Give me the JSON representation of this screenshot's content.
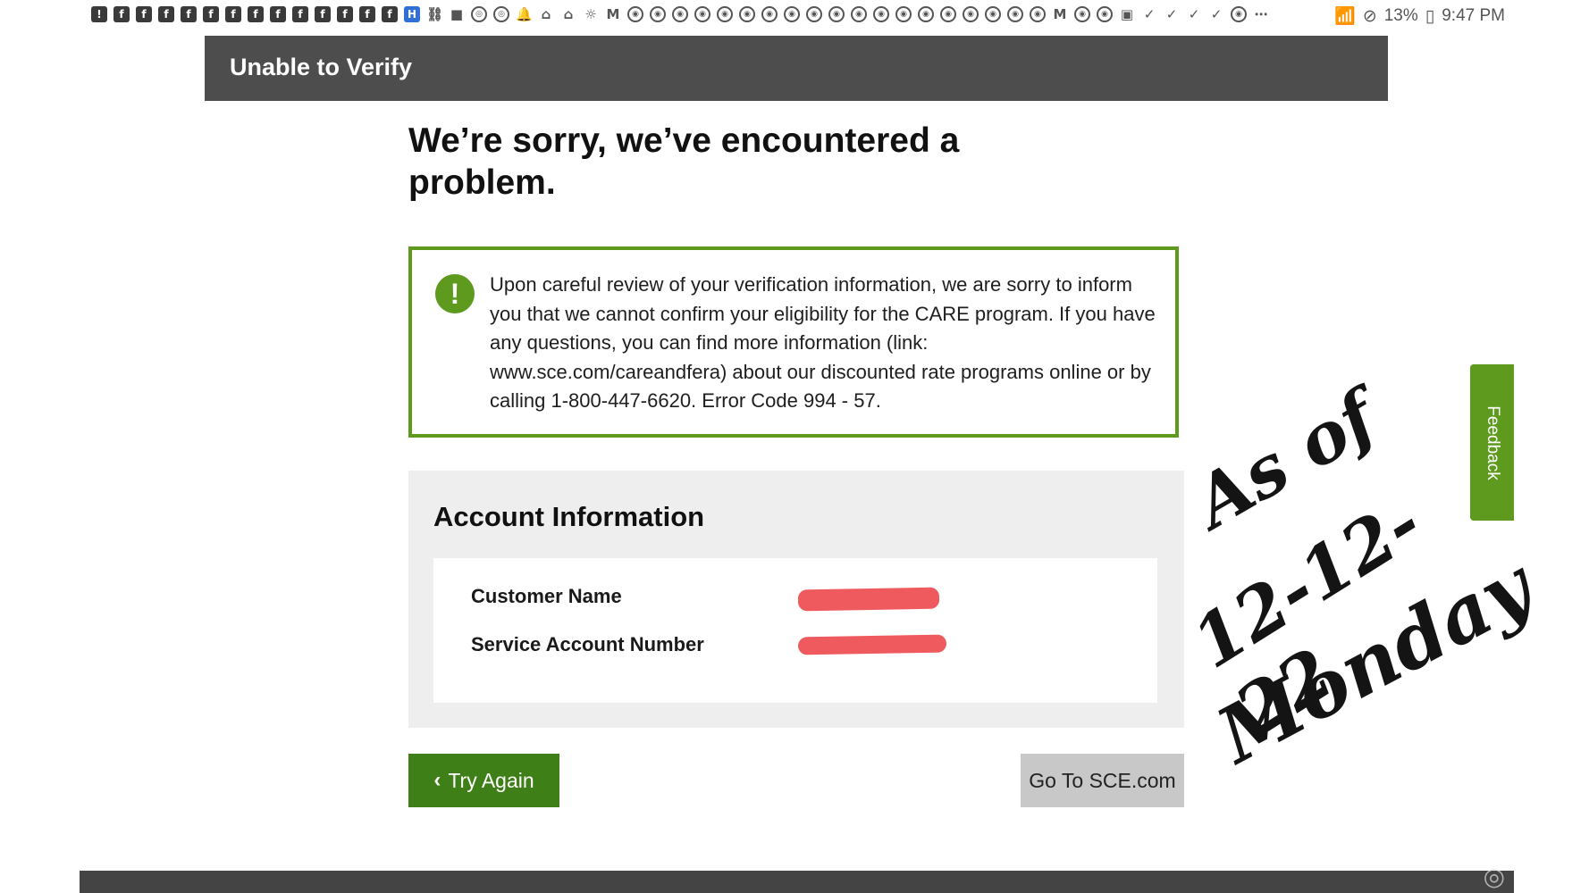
{
  "status_bar": {
    "icons": [
      "notification-icons"
    ],
    "battery": "13%",
    "time": "9:47 PM"
  },
  "header": {
    "title": "Unable to Verify"
  },
  "page": {
    "title": "We’re sorry, we’ve encountered a problem."
  },
  "alert": {
    "message": "Upon careful review of your verification information, we are sorry to inform you that we cannot confirm your eligibility for the CARE program. If you have any questions, you can find more information (link: www.sce.com/careandfera) about our discounted rate programs online or by calling 1-800-447-6620. Error Code 994 - 57."
  },
  "account_info": {
    "title": "Account Information",
    "customer_name_label": "Customer Name",
    "service_account_label": "Service Account Number"
  },
  "buttons": {
    "try_again": "Try Again",
    "go_to_sce": "Go To SCE.com"
  },
  "feedback": {
    "label": "Feedback"
  },
  "handwriting": {
    "line1": "As of",
    "line2": "12-12-22",
    "line3": "Monday"
  },
  "colors": {
    "header_bg": "#4d4d4d",
    "accent_green": "#5e9a1d",
    "try_again_bg": "#3f7f17",
    "redaction": "#ef5a5f"
  }
}
